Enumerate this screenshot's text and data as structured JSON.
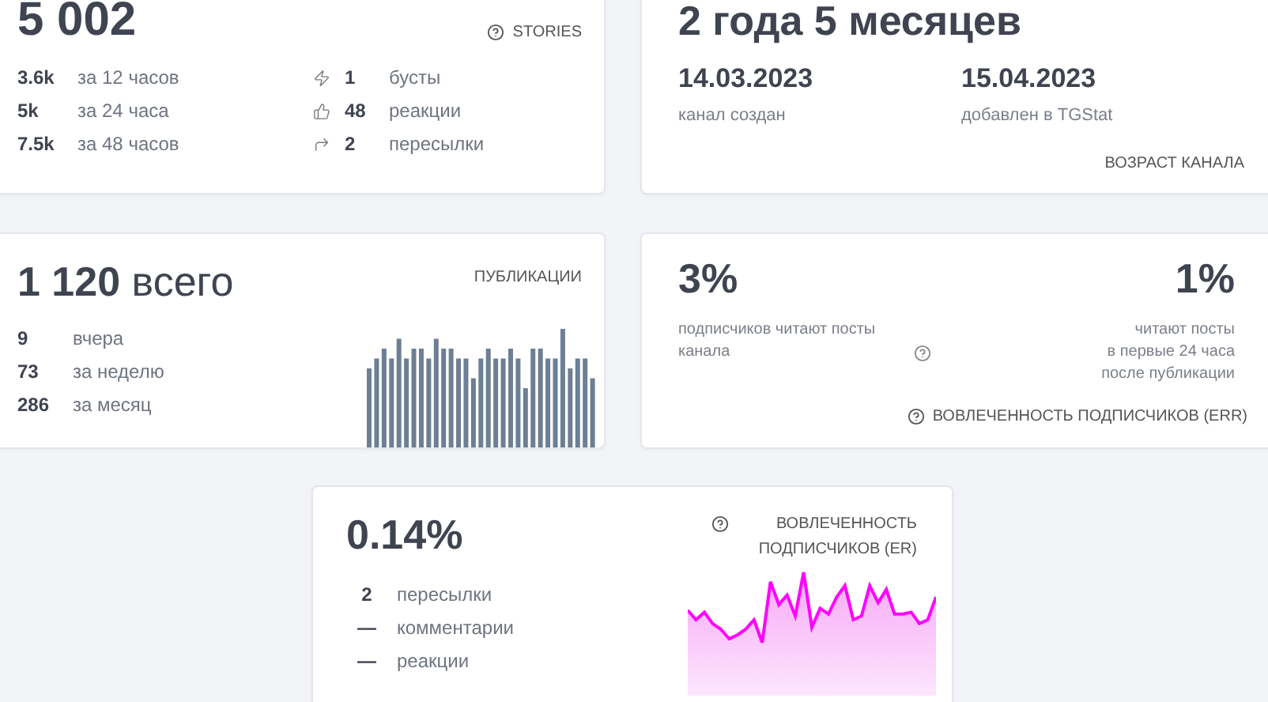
{
  "stories_card": {
    "value": "5 002",
    "title": "STORIES",
    "periods": [
      {
        "value": "3.6k",
        "label": "за 12 часов"
      },
      {
        "value": "5k",
        "label": "за 24 часа"
      },
      {
        "value": "7.5k",
        "label": "за 48 часов"
      }
    ],
    "interactions": [
      {
        "kind": "boost",
        "value": "1",
        "label": "бусты"
      },
      {
        "kind": "reactions",
        "value": "48",
        "label": "реакции"
      },
      {
        "kind": "forwards",
        "value": "2",
        "label": "пересылки"
      }
    ]
  },
  "age_card": {
    "value": "2 года 5 месяцев",
    "dates": [
      {
        "date": "14.03.2023",
        "label": "канал создан"
      },
      {
        "date": "15.04.2023",
        "label": "добавлен в TGStat"
      }
    ],
    "title": "ВОЗРАСТ КАНАЛА"
  },
  "posts_card": {
    "value": "**1 120** всего",
    "title": "ПУБЛИКАЦИИ",
    "rows": [
      {
        "value": "9",
        "label": "вчера"
      },
      {
        "value": "73",
        "label": "за неделю"
      },
      {
        "value": "286",
        "label": "за месяц"
      }
    ]
  },
  "err_card": {
    "left_value": "3%",
    "left_caption": "подписчиков читают посты канала",
    "right_value": "1%",
    "right_caption": [
      "читают посты",
      "в первые 24 часа",
      "после публикации"
    ],
    "title": "ВОВЛЕЧЕННОСТЬ ПОДПИСЧИКОВ (ERR)"
  },
  "er_card": {
    "value": "0.14%",
    "title": "ВОВЛЕЧЕННОСТЬ ПОДПИСЧИКОВ (ER)",
    "rows": [
      {
        "value": "2",
        "label": "пересылки"
      },
      {
        "value": "—",
        "label": "комментарии"
      },
      {
        "value": "—",
        "label": "реакции"
      }
    ]
  }
}
